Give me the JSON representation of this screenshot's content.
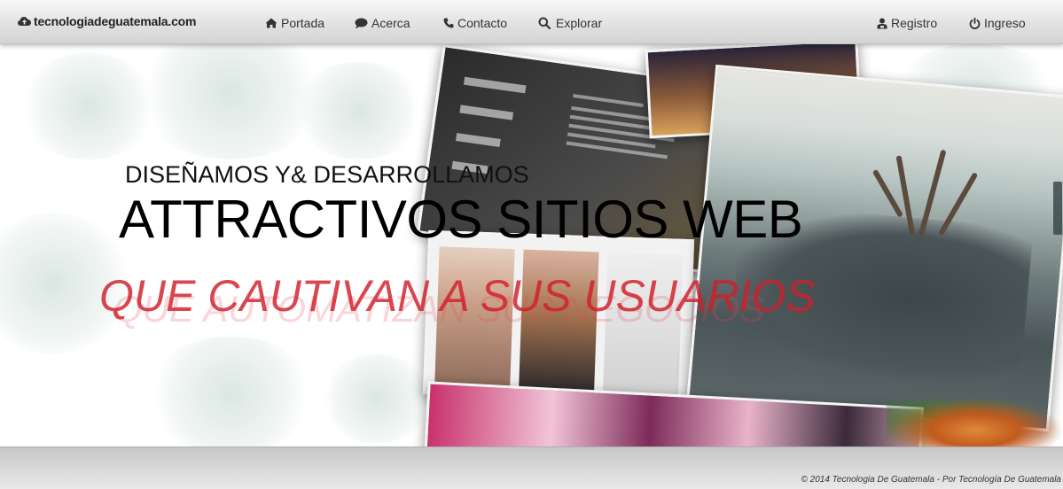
{
  "navbar": {
    "brand": "tecnologiadeguatemala.com",
    "items": [
      {
        "label": "Portada",
        "icon": "home-icon"
      },
      {
        "label": "Acerca",
        "icon": "comment-icon"
      },
      {
        "label": "Contacto",
        "icon": "phone-icon"
      },
      {
        "label": "Explorar",
        "icon": "search-icon"
      }
    ],
    "right": [
      {
        "label": "Registro",
        "icon": "user-icon"
      },
      {
        "label": "Ingreso",
        "icon": "power-icon"
      }
    ]
  },
  "hero": {
    "line1": "DISEÑAMOS Y& DESARROLLAMOS",
    "line2": "ATTRACTIVOS SITIOS WEB",
    "line3": "QUE CAUTIVAN A SUS USUARIOS",
    "line3_ghost": "QUE AUTOMATIZAN SUS NEGOCIOS"
  },
  "footer": {
    "copyright": "© 2014 Tecnologia De Guatemala - Por Tecnología De Guatemala"
  },
  "colors": {
    "accent_red": "#d21e2a",
    "nav_text": "#333333",
    "headline": "#000000"
  }
}
